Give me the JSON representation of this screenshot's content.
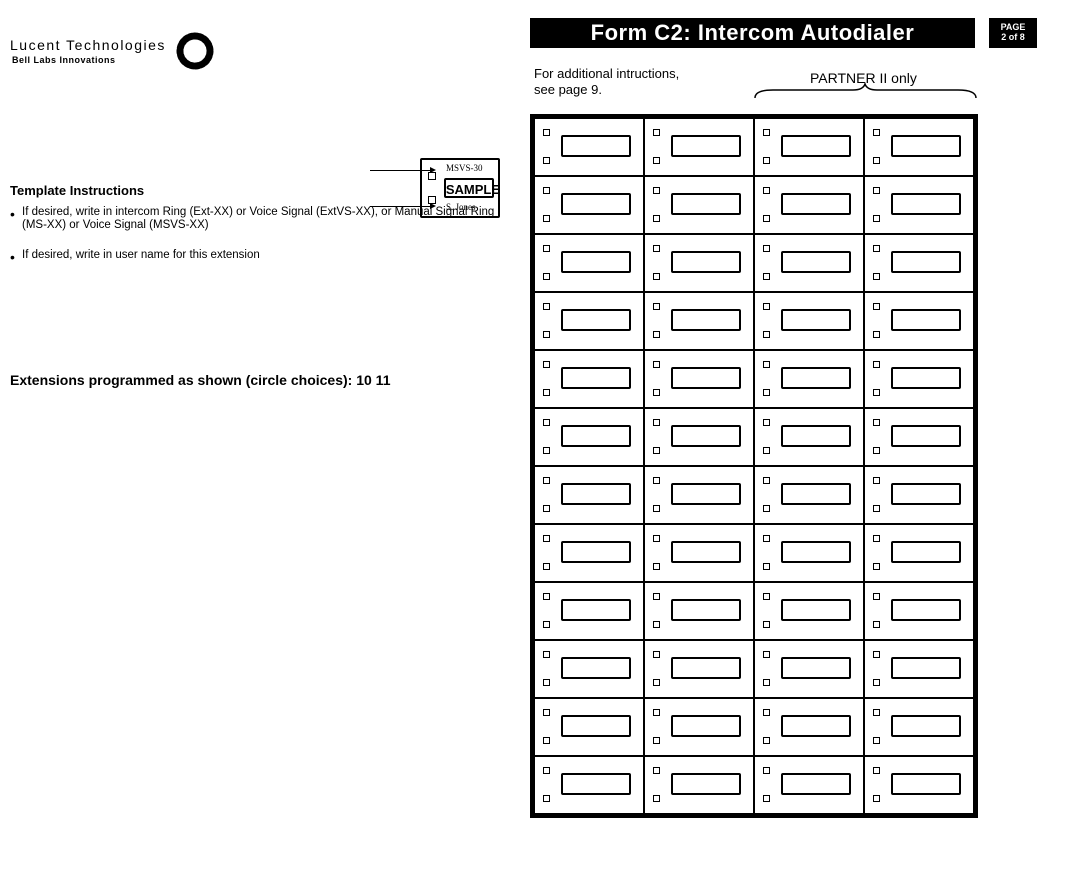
{
  "header": {
    "company": "Lucent Technologies",
    "sub_company": "Bell Labs Innovations",
    "form_title": "Form C2: Intercom Autodialer",
    "page_label": "PAGE",
    "page_value": "2 of 8"
  },
  "right": {
    "additional_instructions_line": "For additional intructions,",
    "additional_instructions_line2": "see page 9.",
    "partner_label": "PARTNER II only"
  },
  "left": {
    "template_instructions_label": "Template Instructions",
    "sample_label": "SAMPLE",
    "bullet1": "If desired, write in intercom Ring (Ext-XX) or Voice Signal (ExtVS-XX), or Manual Signal Ring (MS-XX) or Voice Signal (MSVS-XX)",
    "bullet2": "If desired, write in user name for this extension",
    "sample_top": "MSVS-30",
    "sample_bot": "S. Jones",
    "extensions_line": "Extensions programmed as shown (circle choices): 10 11"
  },
  "grid": {
    "rows": 12,
    "cols": 4
  }
}
